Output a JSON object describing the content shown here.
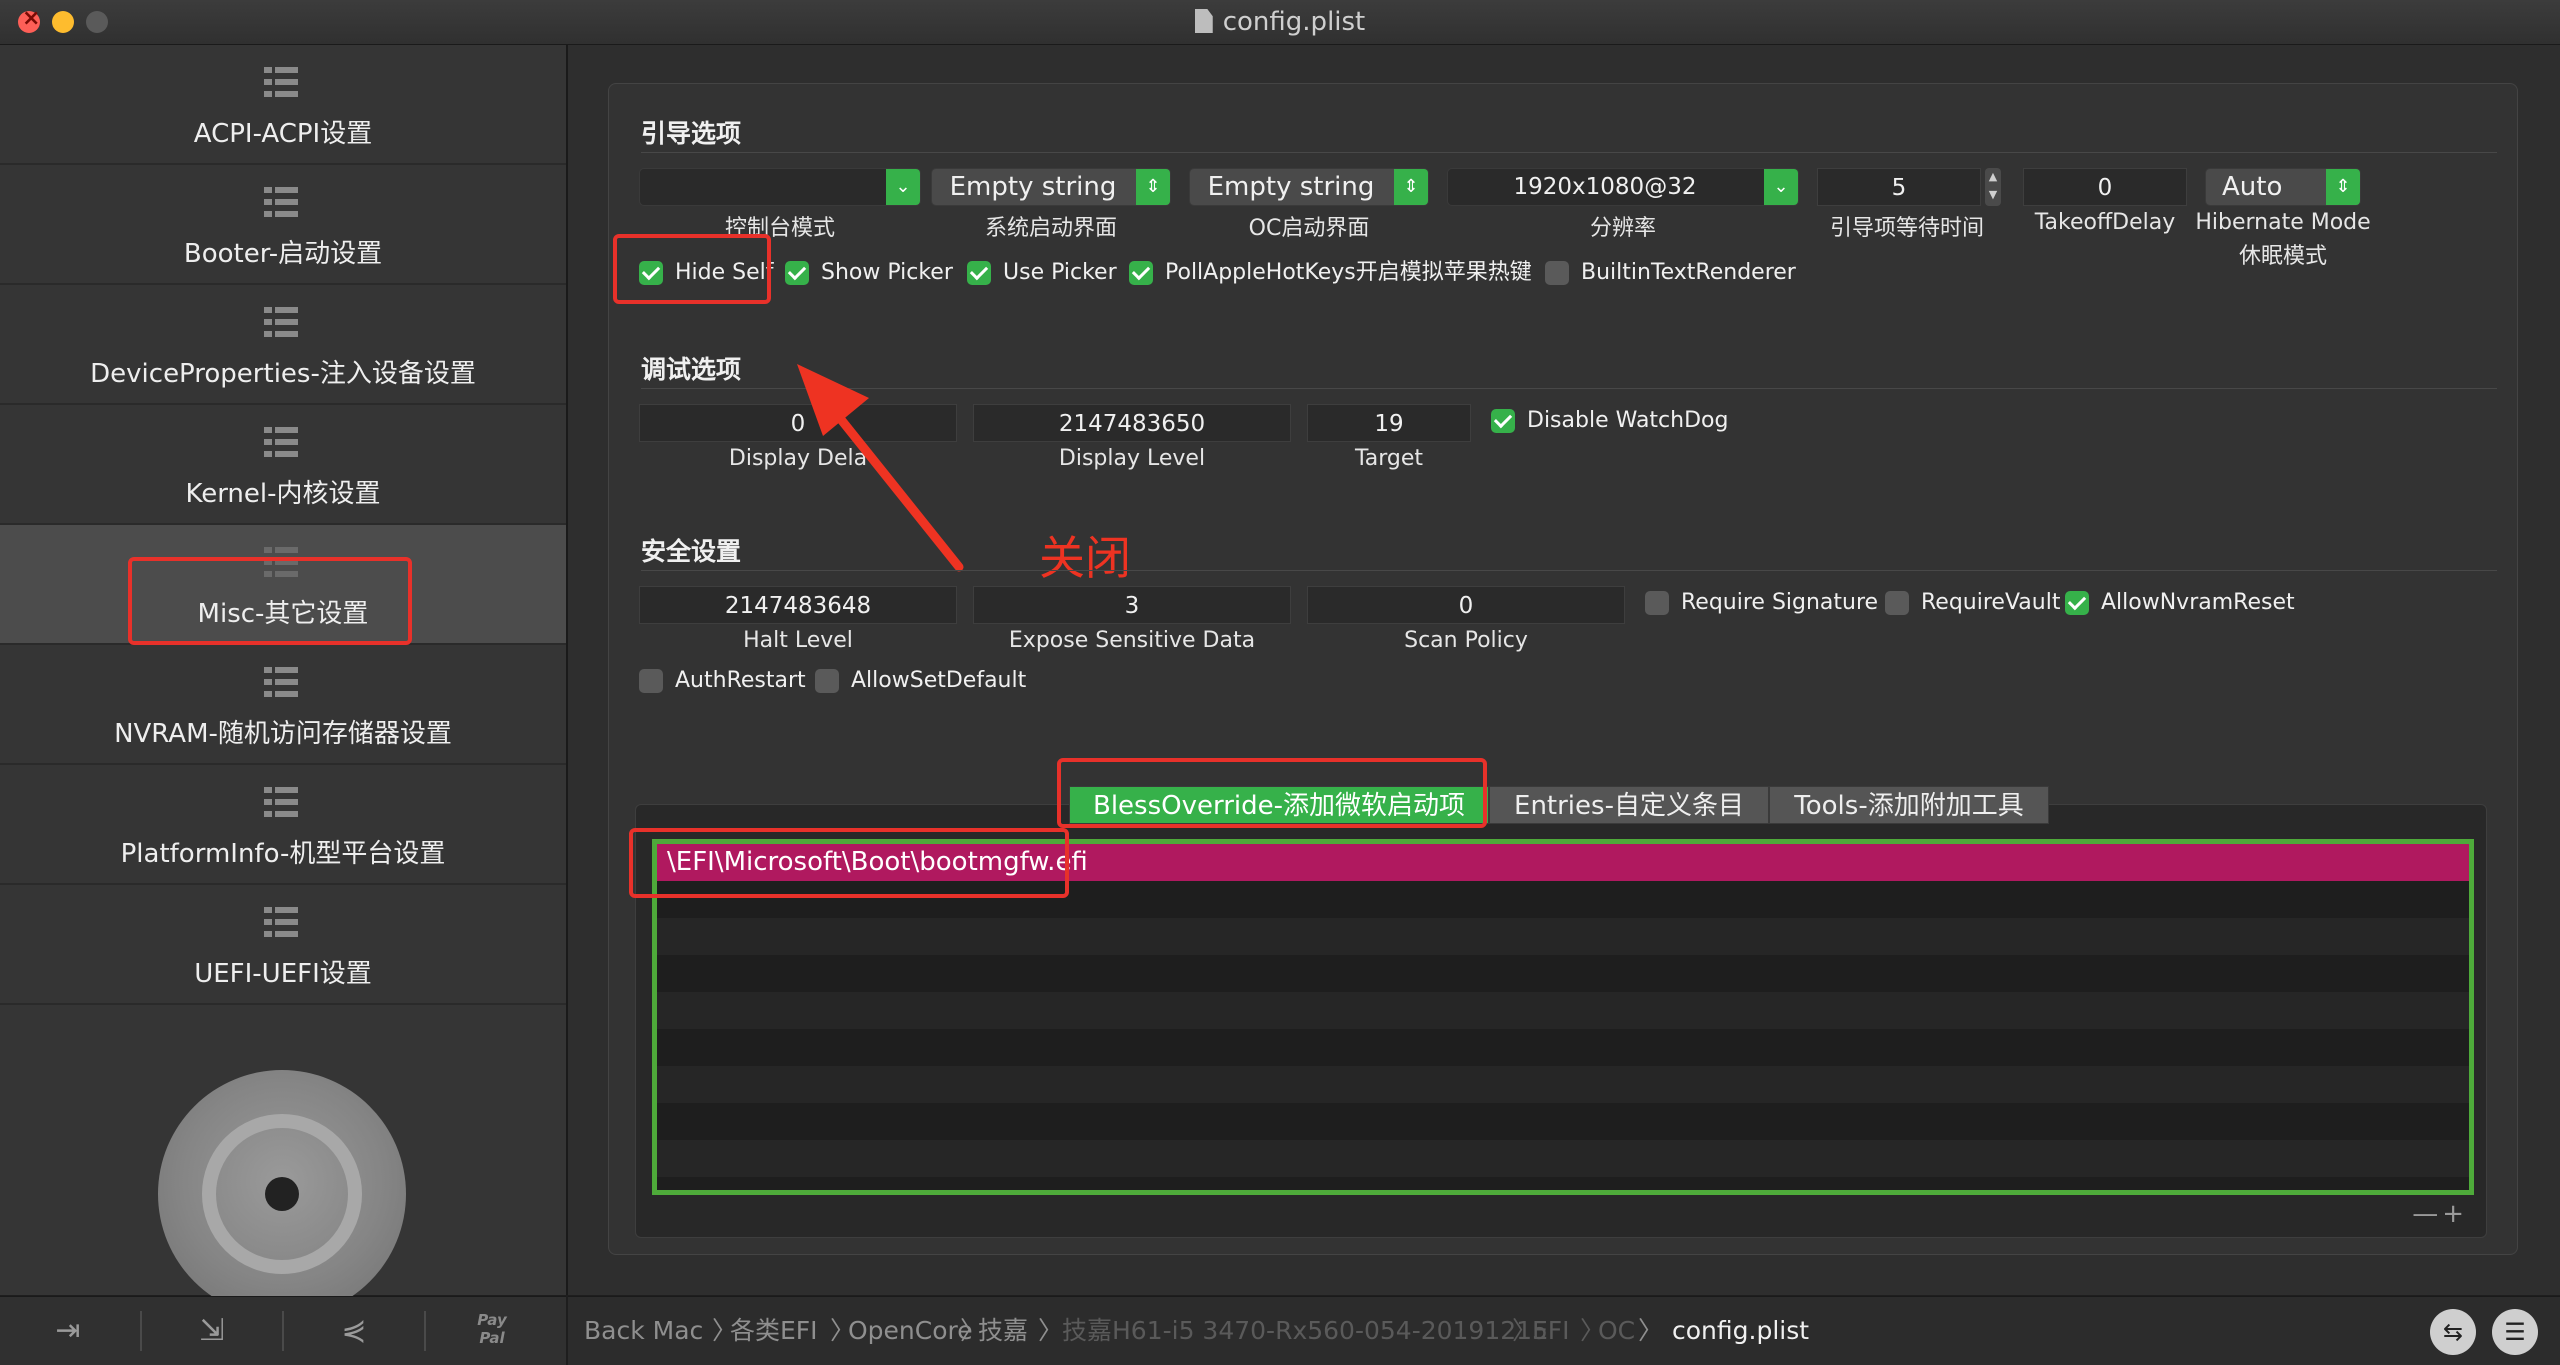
{
  "window": {
    "title": "config.plist"
  },
  "sidebar": {
    "items": [
      {
        "label": "ACPI-ACPI设置"
      },
      {
        "label": "Booter-启动设置"
      },
      {
        "label": "DeviceProperties-注入设备设置"
      },
      {
        "label": "Kernel-内核设置"
      },
      {
        "label": "Misc-其它设置"
      },
      {
        "label": "NVRAM-随机访问存储器设置"
      },
      {
        "label": "PlatformInfo-机型平台设置"
      },
      {
        "label": "UEFI-UEFI设置"
      }
    ],
    "active_index": 4,
    "toolbar": {
      "paypal_label": "Pay\nPal"
    }
  },
  "boot": {
    "section_title": "引导选项",
    "console_mode": {
      "value": "",
      "label": "控制台模式"
    },
    "system_ui": {
      "value": "Empty string",
      "label": "系统启动界面"
    },
    "oc_ui": {
      "value": "Empty string",
      "label": "OC启动界面"
    },
    "resolution": {
      "value": "1920x1080@32",
      "label": "分辨率"
    },
    "timeout": {
      "value": "5",
      "label": "引导项等待时间"
    },
    "takeoff_delay": {
      "value": "0",
      "label": "TakeoffDelay"
    },
    "hibernate_mode": {
      "value": "Auto",
      "label_line1": "Hibernate Mode",
      "label_line2": "休眠模式"
    },
    "checkboxes": [
      {
        "label": "Hide Self",
        "checked": true
      },
      {
        "label": "Show Picker",
        "checked": true
      },
      {
        "label": "Use Picker",
        "checked": true
      },
      {
        "label": "PollAppleHotKeys开启模拟苹果热键",
        "checked": true
      },
      {
        "label": "BuiltinTextRenderer",
        "checked": false
      }
    ]
  },
  "debug": {
    "section_title": "调试选项",
    "display_delay": {
      "value": "0",
      "label": "Display Dela"
    },
    "display_level": {
      "value": "2147483650",
      "label": "Display Level"
    },
    "target": {
      "value": "19",
      "label": "Target"
    },
    "disable_watchdog": {
      "label": "Disable WatchDog",
      "checked": true
    }
  },
  "annotation": {
    "text": "关闭"
  },
  "security": {
    "section_title": "安全设置",
    "halt_level": {
      "value": "2147483648",
      "label": "Halt Level"
    },
    "expose_sensitive": {
      "value": "3",
      "label": "Expose Sensitive Data"
    },
    "scan_policy": {
      "value": "0",
      "label": "Scan Policy"
    },
    "checkboxes": [
      {
        "label": "Require Signature",
        "checked": false
      },
      {
        "label": "RequireVault",
        "checked": false
      },
      {
        "label": "AllowNvramReset",
        "checked": true
      },
      {
        "label": "AuthRestart",
        "checked": false
      },
      {
        "label": "AllowSetDefault",
        "checked": false
      }
    ]
  },
  "tabs": [
    {
      "label": "BlessOverride-添加微软启动项",
      "active": true
    },
    {
      "label": "Entries-自定义条目",
      "active": false
    },
    {
      "label": "Tools-添加附加工具",
      "active": false
    }
  ],
  "bless_table": {
    "rows": [
      "\\EFI\\Microsoft\\Boot\\bootmgfw.efi"
    ],
    "controls": "—+"
  },
  "breadcrumb": {
    "items": [
      {
        "label": "Back Mac",
        "style": "normal"
      },
      {
        "label": "各类EFI",
        "style": "normal"
      },
      {
        "label": "OpenCore",
        "style": "normal"
      },
      {
        "label": "技嘉",
        "style": "normal"
      },
      {
        "label": "技嘉H61-i5 3470-Rx560-054-20191215",
        "style": "dim"
      },
      {
        "label": "EFI",
        "style": "dim"
      },
      {
        "label": "OC",
        "style": "dim"
      },
      {
        "label": "config.plist",
        "style": "current"
      }
    ]
  },
  "colors": {
    "accent_green": "#36b14a",
    "selection": "#b0195f",
    "annotation_red": "#e8312a"
  }
}
